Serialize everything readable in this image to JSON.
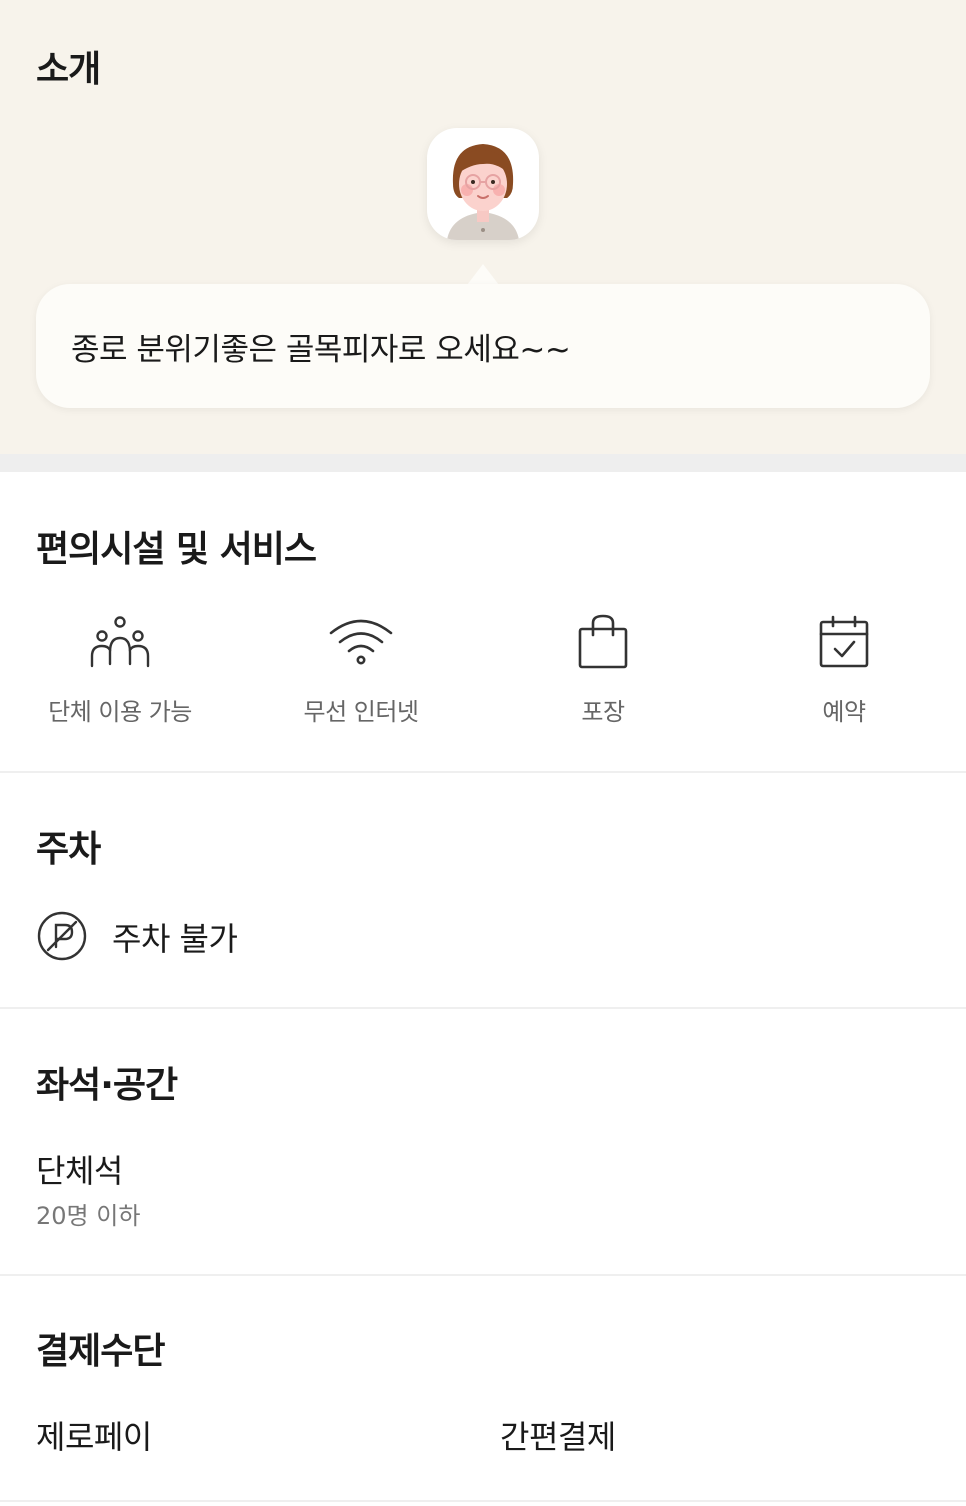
{
  "intro": {
    "title": "소개",
    "message": "종로 분위기좋은 골목피자로 오세요~~"
  },
  "amenities": {
    "title": "편의시설 및 서비스",
    "items": [
      {
        "label": "단체 이용 가능",
        "icon": "group-icon"
      },
      {
        "label": "무선 인터넷",
        "icon": "wifi-icon"
      },
      {
        "label": "포장",
        "icon": "shopping-bag-icon"
      },
      {
        "label": "예약",
        "icon": "calendar-check-icon"
      }
    ]
  },
  "parking": {
    "title": "주차",
    "status": "주차 불가",
    "icon": "no-parking-icon"
  },
  "seating": {
    "title": "좌석·공간",
    "seat_name": "단체석",
    "seat_capacity": "20명 이하"
  },
  "payment": {
    "title": "결제수단",
    "methods": [
      "제로페이",
      "간편결제"
    ]
  },
  "colors": {
    "intro_background": "#f7f3eb",
    "bubble_background": "#fdfcf8",
    "label_gray": "#666666",
    "divider": "#efefef"
  }
}
